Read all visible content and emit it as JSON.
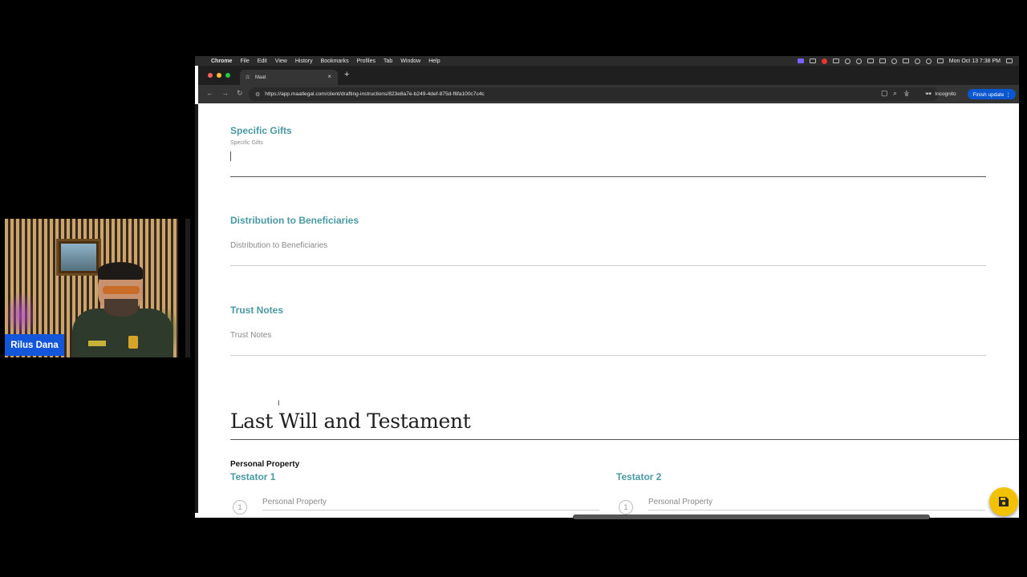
{
  "menubar": {
    "app": "Chrome",
    "items": [
      "File",
      "Edit",
      "View",
      "History",
      "Bookmarks",
      "Profiles",
      "Tab",
      "Window",
      "Help"
    ],
    "clock": "Mon Oct 13  7:38 PM"
  },
  "tab": {
    "title": "Maat",
    "close": "×",
    "new_tab": "+"
  },
  "toolbar": {
    "url": "https://app.maatlegal.com/client/drafting-instructions/823e8a7e-b249-4def-875d-f6fa100c7c4c",
    "incognito_label": "Incognito",
    "finish_update_label": "Finish update ⋮"
  },
  "page": {
    "specific_gifts": {
      "heading": "Specific Gifts",
      "label": "Specific Gifts"
    },
    "distribution": {
      "heading": "Distribution to Beneficiaries",
      "label": "Distribution to Beneficiaries"
    },
    "trust_notes": {
      "heading": "Trust Notes",
      "label": "Trust Notes"
    },
    "will_title": "Last Will and Testament",
    "personal_property_heading": "Personal Property",
    "testator_1": {
      "heading": "Testator 1",
      "step": "1",
      "label": "Personal Property"
    },
    "testator_2": {
      "heading": "Testator 2",
      "step": "1",
      "label": "Personal Property"
    }
  },
  "colors": {
    "accent": "#4a9aa3",
    "fab": "#f2c200",
    "nameplate": "#1456d9"
  },
  "icons": {
    "fab": "save-icon"
  },
  "webcam": {
    "name": "Rilus Dana"
  }
}
